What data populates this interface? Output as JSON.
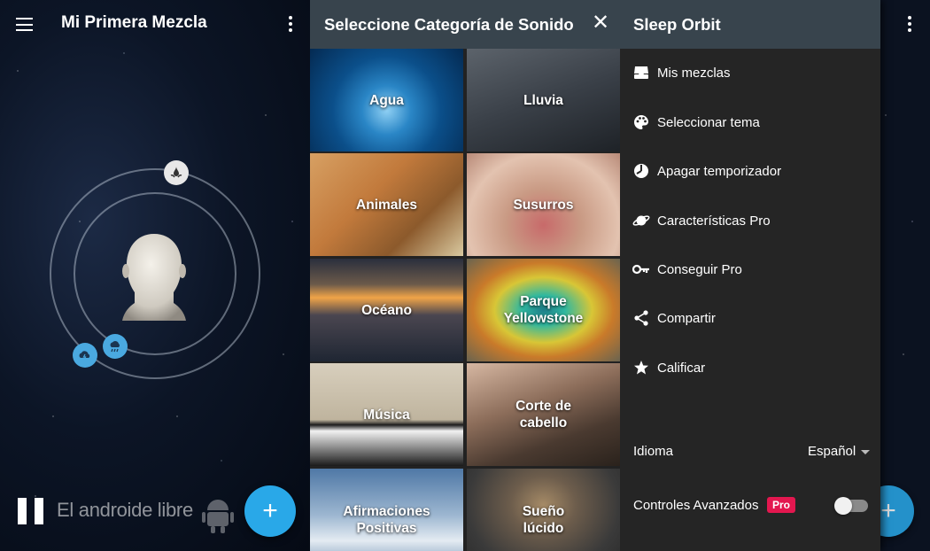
{
  "mix_panel": {
    "title": "Mi Primera Mezcla",
    "watermark": "El androide libre",
    "fab_label": "+"
  },
  "category_panel": {
    "title": "Seleccione Categoría de Sonido",
    "close_label": "✕",
    "categories": [
      {
        "label": "Agua"
      },
      {
        "label": "Lluvia"
      },
      {
        "label": "Animales"
      },
      {
        "label": "Susurros"
      },
      {
        "label": "Océano"
      },
      {
        "label": "Parque Yellowstone"
      },
      {
        "label": "Música"
      },
      {
        "label": "Corte de cabello"
      },
      {
        "label": "Afirmaciones Positivas"
      },
      {
        "label": "Sueño lúcido"
      }
    ]
  },
  "drawer": {
    "title": "Sleep Orbit",
    "items": [
      {
        "label": "Mis mezclas",
        "icon": "inbox-icon"
      },
      {
        "label": "Seleccionar tema",
        "icon": "palette-icon"
      },
      {
        "label": "Apagar temporizador",
        "icon": "timer-icon"
      },
      {
        "label": "Características Pro",
        "icon": "planet-icon"
      },
      {
        "label": "Conseguir Pro",
        "icon": "key-icon"
      },
      {
        "label": "Compartir",
        "icon": "share-icon"
      },
      {
        "label": "Calificar",
        "icon": "star-icon"
      }
    ],
    "language_label": "Idioma",
    "language_value": "Español",
    "advanced_label": "Controles Avanzados",
    "pro_badge": "Pro",
    "advanced_enabled": false
  },
  "colors": {
    "accent": "#29a8e8",
    "appbar": "#38444d",
    "drawer_bg": "#252525",
    "pro_badge": "#e3174f"
  }
}
